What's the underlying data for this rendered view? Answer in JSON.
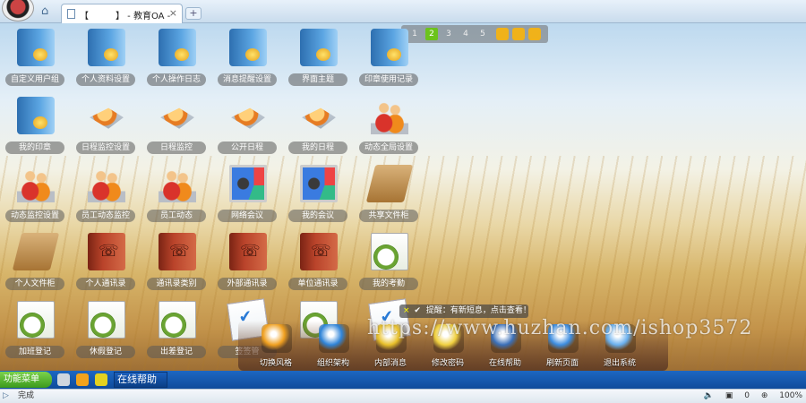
{
  "browser": {
    "tab_title": "【　　　】 - 教育OA -",
    "tab_close": "×",
    "new_tab": "+"
  },
  "pager": {
    "pages": [
      "1",
      "2",
      "3",
      "4",
      "5"
    ],
    "active_page": "2",
    "tools": [
      {
        "name": "grid",
        "color": "#f0b21a"
      },
      {
        "name": "gear",
        "color": "#f0b21a"
      },
      {
        "name": "search",
        "color": "#f0b21a"
      }
    ]
  },
  "desktop_icons": [
    {
      "label": "自定义用户组",
      "icon": "book-icon",
      "kind": "book"
    },
    {
      "label": "个人资料设置",
      "icon": "book-icon",
      "kind": "book"
    },
    {
      "label": "个人操作日志",
      "icon": "book-icon",
      "kind": "book"
    },
    {
      "label": "消息提醒设置",
      "icon": "book-icon",
      "kind": "book"
    },
    {
      "label": "界面主题",
      "icon": "book-icon",
      "kind": "book"
    },
    {
      "label": "印章使用记录",
      "icon": "book-icon",
      "kind": "book"
    },
    {
      "label": "我的印章",
      "icon": "book-icon",
      "kind": "book"
    },
    {
      "label": "日程监控设置",
      "icon": "schedule-icon",
      "kind": "disc"
    },
    {
      "label": "日程监控",
      "icon": "schedule-icon",
      "kind": "disc"
    },
    {
      "label": "公开日程",
      "icon": "schedule-icon",
      "kind": "disc"
    },
    {
      "label": "我的日程",
      "icon": "schedule-icon",
      "kind": "disc"
    },
    {
      "label": "动态全局设置",
      "icon": "people-icon",
      "kind": "people"
    },
    {
      "label": "动态监控设置",
      "icon": "people-icon",
      "kind": "people"
    },
    {
      "label": "员工动态监控",
      "icon": "people-icon",
      "kind": "people"
    },
    {
      "label": "员工动态",
      "icon": "people-icon",
      "kind": "people"
    },
    {
      "label": "网络会议",
      "icon": "meeting-board-icon",
      "kind": "board"
    },
    {
      "label": "我的会议",
      "icon": "meeting-board-icon",
      "kind": "board"
    },
    {
      "label": "共享文件柜",
      "icon": "folder-icon",
      "kind": "folder"
    },
    {
      "label": "个人文件柜",
      "icon": "folder-icon",
      "kind": "folder"
    },
    {
      "label": "个人通讯录",
      "icon": "address-book-icon",
      "kind": "red-book"
    },
    {
      "label": "通讯录类别",
      "icon": "address-book-icon",
      "kind": "red-book"
    },
    {
      "label": "外部通讯录",
      "icon": "address-book-icon",
      "kind": "red-book"
    },
    {
      "label": "单位通讯录",
      "icon": "address-book-icon",
      "kind": "red-book"
    },
    {
      "label": "我的考勤",
      "icon": "clock-icon",
      "kind": "clock"
    },
    {
      "label": "加班登记",
      "icon": "clock-icon",
      "kind": "clock"
    },
    {
      "label": "休假登记",
      "icon": "clock-icon",
      "kind": "clock"
    },
    {
      "label": "出差登记",
      "icon": "clock-icon",
      "kind": "clock"
    },
    {
      "label": "签签管",
      "icon": "checklist-icon",
      "kind": "note"
    },
    {
      "label": "",
      "icon": "clock-icon",
      "kind": "clock"
    },
    {
      "label": "",
      "icon": "checklist-icon",
      "kind": "note"
    }
  ],
  "notice": {
    "close": "×",
    "check": "✔",
    "text": "提醒：有新短息，点击查看！"
  },
  "watermark": "https://www.huzhan.com/ishop3572",
  "dock": [
    {
      "label": "切换风格",
      "icon": "windows-icon",
      "color": "#f0a020"
    },
    {
      "label": "组织架构",
      "icon": "organization-icon",
      "color": "#2f84d8"
    },
    {
      "label": "内部消息",
      "icon": "message-icon",
      "color": "#e8c02a"
    },
    {
      "label": "修改密码",
      "icon": "password-icon",
      "color": "#f0d040"
    },
    {
      "label": "在线帮助",
      "icon": "help-icon",
      "color": "#3a6fb8"
    },
    {
      "label": "刷新页面",
      "icon": "refresh-icon",
      "color": "#3d8de0"
    },
    {
      "label": "退出系统",
      "icon": "exit-icon",
      "color": "#6ab0ee"
    }
  ],
  "taskbar": {
    "start_label": "功能菜单",
    "quick_icons": [
      {
        "name": "desktop",
        "color": "#cfd6de"
      },
      {
        "name": "chat",
        "color": "#f2a31c"
      },
      {
        "name": "users",
        "color": "#e4d21f"
      }
    ],
    "active_window": "在线帮助"
  },
  "statusbar": {
    "status": "完成",
    "popup_count": "0",
    "zoom": "100%"
  }
}
